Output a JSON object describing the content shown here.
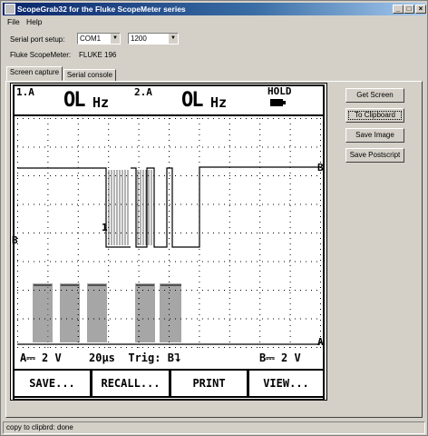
{
  "window": {
    "title": "ScopeGrab32 for the Fluke ScopeMeter series"
  },
  "menu": [
    "File",
    "Help"
  ],
  "setup": {
    "serial_label": "Serial port setup:",
    "port_value": "COM1",
    "baud_value": "1200",
    "meter_label": "Fluke ScopeMeter:",
    "meter_value": "FLUKE 196"
  },
  "tabs": [
    "Screen capture",
    "Serial console"
  ],
  "buttons": {
    "get_screen": "Get Screen",
    "clipboard": "To Clipboard",
    "save_image": "Save Image",
    "save_postscript": "Save Postscript"
  },
  "scope": {
    "ch1_label": "1.A",
    "ch1_value": "OL",
    "ch1_unit": "Hz",
    "ch2_label": "2.A",
    "ch2_value": "OL",
    "ch2_unit": "Hz",
    "hold": "HOLD",
    "marker_b_left": "B",
    "marker_b_right": "B",
    "marker_a_right": "A",
    "marker_1": "1",
    "bottom_left": "A⎓ 2 V",
    "bottom_mid": "20µs  Trig: B⮧",
    "bottom_right": "B⎓ 2 V",
    "softkeys": [
      "SAVE...",
      "RECALL...",
      "PRINT",
      "VIEW..."
    ]
  },
  "status": "copy to clipbrd: done"
}
